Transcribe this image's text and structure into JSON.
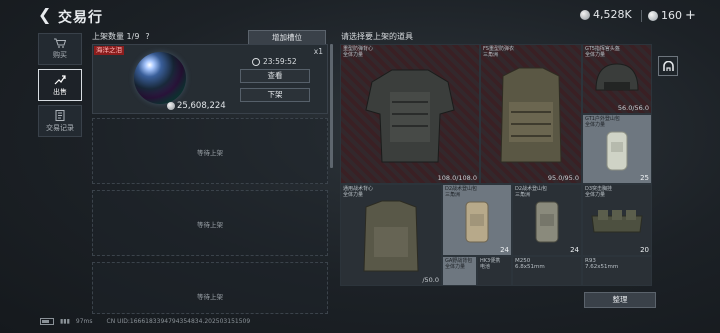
{
  "header": {
    "back_label": "❮",
    "title": "交易行",
    "silver": "4,528K",
    "gold": "160",
    "plus": "+"
  },
  "nav": [
    {
      "label": "购买",
      "icon": "cart-icon"
    },
    {
      "label": "出售",
      "icon": "sell-icon"
    },
    {
      "label": "交易记录",
      "icon": "record-icon"
    }
  ],
  "listings": {
    "header": "上架数量 1/9",
    "help": "?",
    "add_slot": "增加槽位",
    "item": {
      "tag": "海洋之泪",
      "qty": "x1",
      "price": "25,608,224",
      "timer": "23:59:52",
      "view": "查看",
      "delist": "下架"
    },
    "waiting": [
      "等待上架",
      "等待上架",
      "等待上架"
    ]
  },
  "inventory": {
    "header": "请选择要上架的道具",
    "items": [
      {
        "name": "重型防弹背心\n全体力量",
        "dur": "108.0/108.0"
      },
      {
        "name": "FS重型防弹衣\n三角洲",
        "dur": "95.0/95.0"
      },
      {
        "name": "GT5指挥官头盔\n全体力量",
        "dur": "56.0/56.0"
      },
      {
        "name": "GT1户外登山包\n全体力量",
        "count": "25"
      },
      {
        "name": "通用战术背心\n全体力量",
        "dur": "/50.0"
      },
      {
        "name": "D2战术登山包\n三角洲",
        "count": "24"
      },
      {
        "name": "D2战术登山包\n三角洲",
        "count": "24"
      },
      {
        "name": "D3突击胸挂\n全体力量",
        "count": "20"
      },
      {
        "name": "GA野战背包\n全体力量",
        "count": ""
      },
      {
        "name": "HK3便携\n电池",
        "count": ""
      },
      {
        "name": "M250\n6.8x51mm",
        "count": ""
      },
      {
        "name": "R93\n7.62x51mm",
        "count": ""
      }
    ],
    "sort": "整理"
  },
  "footer": {
    "ping": "97ms",
    "uid": "CN UID:1666183394794354834.202503151509"
  }
}
